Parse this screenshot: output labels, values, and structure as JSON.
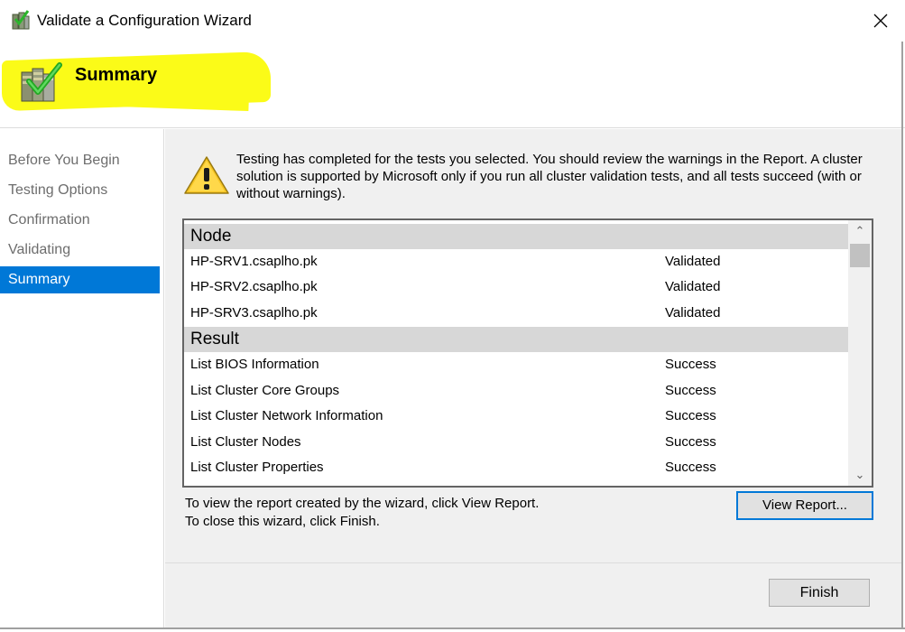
{
  "window": {
    "title": "Validate a Configuration Wizard",
    "close_icon": "close-icon"
  },
  "header": {
    "title": "Summary",
    "icon": "cluster-validate-icon",
    "highlight_color": "#fbfb18"
  },
  "nav": {
    "items": [
      {
        "label": "Before You Begin",
        "active": false
      },
      {
        "label": "Testing Options",
        "active": false
      },
      {
        "label": "Confirmation",
        "active": false
      },
      {
        "label": "Validating",
        "active": false
      },
      {
        "label": "Summary",
        "active": true
      }
    ],
    "active_color": "#0078d7"
  },
  "content": {
    "warning_icon": "warning-icon",
    "message": "Testing has completed for the tests you selected. You should review the warnings in the Report.  A cluster solution is supported by Microsoft only if you run all cluster validation tests, and all tests succeed (with or without warnings).",
    "groups": [
      {
        "header": "Node",
        "rows": [
          {
            "name": "HP-SRV1.csaplho.pk",
            "status": "Validated"
          },
          {
            "name": "HP-SRV2.csaplho.pk",
            "status": "Validated"
          },
          {
            "name": "HP-SRV3.csaplho.pk",
            "status": "Validated"
          }
        ]
      },
      {
        "header": "Result",
        "rows": [
          {
            "name": "List BIOS Information",
            "status": "Success"
          },
          {
            "name": "List Cluster Core Groups",
            "status": "Success"
          },
          {
            "name": "List Cluster Network Information",
            "status": "Success"
          },
          {
            "name": "List Cluster Nodes",
            "status": "Success"
          },
          {
            "name": "List Cluster Properties",
            "status": "Success"
          }
        ]
      }
    ],
    "info_line1": "To view the report created by the wizard, click View Report.",
    "info_line2": "To close this wizard, click Finish.",
    "view_report_label": "View Report..."
  },
  "footer": {
    "finish_label": "Finish"
  }
}
